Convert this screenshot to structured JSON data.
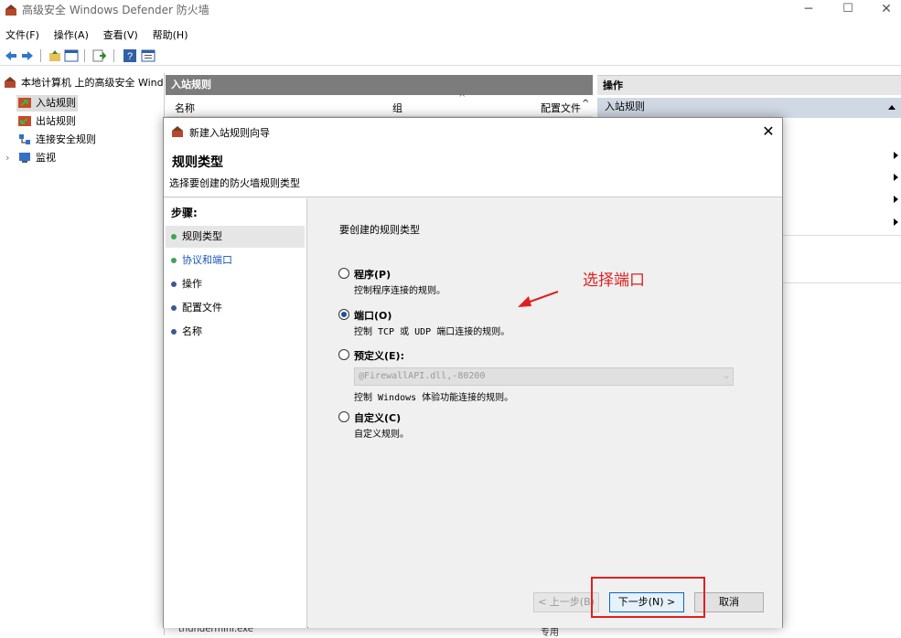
{
  "window": {
    "title": "高级安全 Windows Defender 防火墙",
    "min": "─",
    "max": "☐",
    "close": "✕"
  },
  "menu": [
    "文件(F)",
    "操作(A)",
    "查看(V)",
    "帮助(H)"
  ],
  "tree": {
    "root": "本地计算机 上的高级安全 Wind",
    "items": [
      "入站规则",
      "出站规则",
      "连接安全规则",
      "监视"
    ]
  },
  "middle": {
    "header": "入站规则",
    "columns": [
      "名称",
      "组",
      "配置文件"
    ],
    "bottom_row": {
      "name": "thundermini.exe",
      "profile": "专用"
    }
  },
  "actions": {
    "header": "操作",
    "subheader": "入站规则"
  },
  "dialog": {
    "title": "新建入站规则向导",
    "close": "✕",
    "heading": "规则类型",
    "subheading": "选择要创建的防火墙规则类型",
    "steps_title": "步骤:",
    "steps": [
      "规则类型",
      "协议和端口",
      "操作",
      "配置文件",
      "名称"
    ],
    "prompt": "要创建的规则类型",
    "options": [
      {
        "label": "程序(P)",
        "desc": "控制程序连接的规则。",
        "selected": false
      },
      {
        "label": "端口(O)",
        "desc": "控制 TCP 或 UDP 端口连接的规则。",
        "selected": true
      },
      {
        "label": "预定义(E):",
        "desc": "控制 Windows 体验功能连接的规则。",
        "selected": false
      },
      {
        "label": "自定义(C)",
        "desc": "自定义规则。",
        "selected": false
      }
    ],
    "predefined_value": "@FirewallAPI.dll,-80200",
    "buttons": {
      "back": "< 上一步(B)",
      "next": "下一步(N) >",
      "cancel": "取消"
    }
  },
  "annotation": {
    "text": "选择端口",
    "color": "#e02020"
  }
}
